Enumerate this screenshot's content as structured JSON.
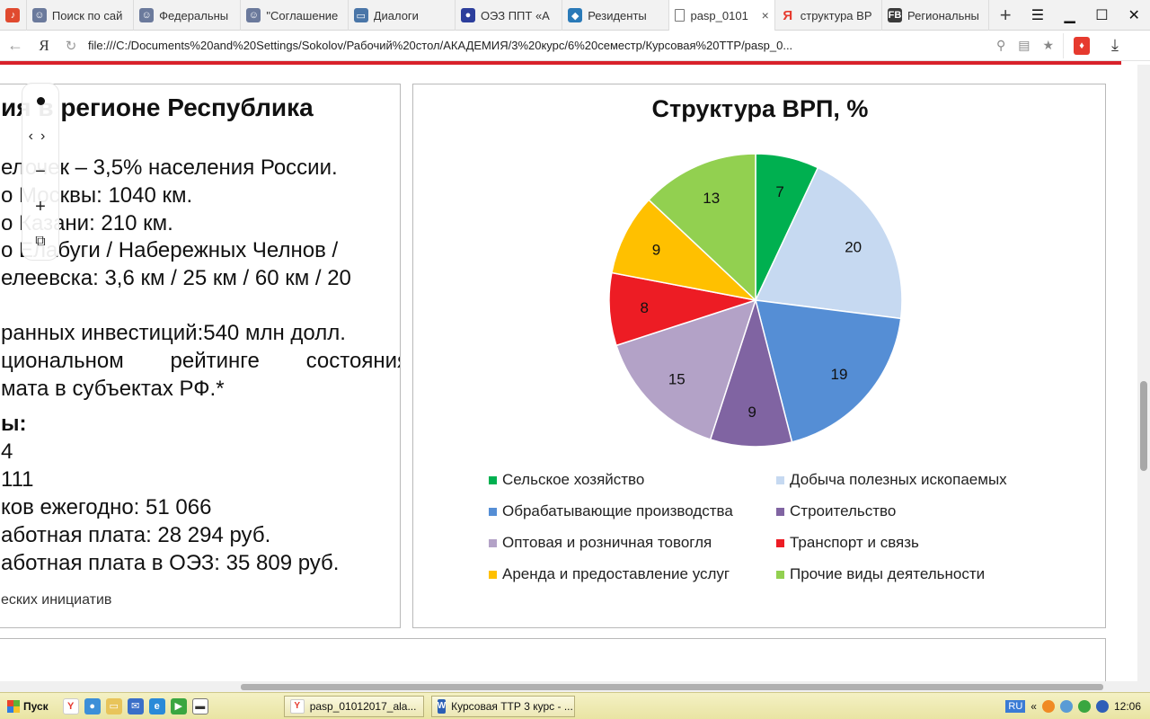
{
  "browser": {
    "tabs": [
      {
        "label": "",
        "icon": "music-icon",
        "color": "#e04a2f",
        "active": false
      },
      {
        "label": "Поиск по сай",
        "icon": "avatar-icon",
        "color": "#6b7a9c",
        "active": false
      },
      {
        "label": "Федеральны",
        "icon": "avatar-icon",
        "color": "#6b7a9c",
        "active": false
      },
      {
        "label": "\"Соглашение",
        "icon": "avatar-icon",
        "color": "#6b7a9c",
        "active": false
      },
      {
        "label": "Диалоги",
        "icon": "chat-icon",
        "color": "#4a76a8",
        "active": false
      },
      {
        "label": "ОЭЗ ППТ «А",
        "icon": "globe-icon",
        "color": "#2c3e9c",
        "active": false
      },
      {
        "label": "Резиденты",
        "icon": "diamond-icon",
        "color": "#2a7ab8",
        "active": false
      },
      {
        "label": "pasp_0101",
        "icon": "document-icon",
        "color": "#777777",
        "active": true,
        "close": "×"
      },
      {
        "label": "структура ВР",
        "icon": "yandex-icon",
        "color": "#e63a2e",
        "active": false
      },
      {
        "label": "Региональны",
        "icon": "fb-icon",
        "color": "#3b3b3b",
        "active": false
      }
    ],
    "add_tab": "+",
    "url": "file:///C:/Documents%20and%20Settings/Sokolov/Рабочий%20стол/АКАДЕМИЯ/3%20курс/6%20семестр/Курсовая%20ТТР/pasp_0...",
    "logo": "Я"
  },
  "left_slide": {
    "heading": "ия в регионе Республика",
    "lines": [
      "елочек – 3,5% населения России.",
      "о Москвы: 1040 км.",
      "о Казани:  210 км.",
      "о Елабуги / Набережных Челнов /",
      "елеевска: 3,6 км / 25 км / 60 км / 20"
    ],
    "invest_line": "ранных инвестиций:540 млн долл.",
    "rating_words": [
      "циональном",
      "рейтинге",
      "состояния"
    ],
    "climate_line": "мата в субъектах РФ.*",
    "subheading": "ы:",
    "stats": [
      "4",
      "111",
      "ков ежегодно: 51 066",
      "аботная плата: 28 294 руб.",
      "аботная плата в ОЭЗ: 35 809 руб."
    ],
    "footnote": "еских инициатив"
  },
  "chart_data": {
    "type": "pie",
    "title": "Структура ВРП, %",
    "legend_position": "bottom",
    "slices": [
      {
        "name": "Сельское хозяйство",
        "value": 7,
        "color": "#00b050"
      },
      {
        "name": "Добыча полезных ископаемых",
        "value": 20,
        "color": "#c6d9f1"
      },
      {
        "name": "Обрабатывающие производства",
        "value": 19,
        "color": "#558ed5"
      },
      {
        "name": "Строительство",
        "value": 9,
        "color": "#8064a2"
      },
      {
        "name": "Оптовая и розничная товогля",
        "value": 15,
        "color": "#b3a2c7"
      },
      {
        "name": "Транспорт и связь",
        "value": 8,
        "color": "#ed1c24"
      },
      {
        "name": "Аренда и предоставление услуг",
        "value": 9,
        "color": "#ffc000"
      },
      {
        "name": "Прочие виды деятельности",
        "value": 13,
        "color": "#92d050"
      }
    ]
  },
  "taskbar": {
    "start_label": "Пуск",
    "items": [
      {
        "label": "pasp_01012017_ala...",
        "icon": "yandex-icon"
      },
      {
        "label": "Курсовая ТТР 3 курс - ...",
        "icon": "word-icon"
      }
    ],
    "lang": "RU",
    "time": "12:06",
    "tray_arrow": "«"
  }
}
